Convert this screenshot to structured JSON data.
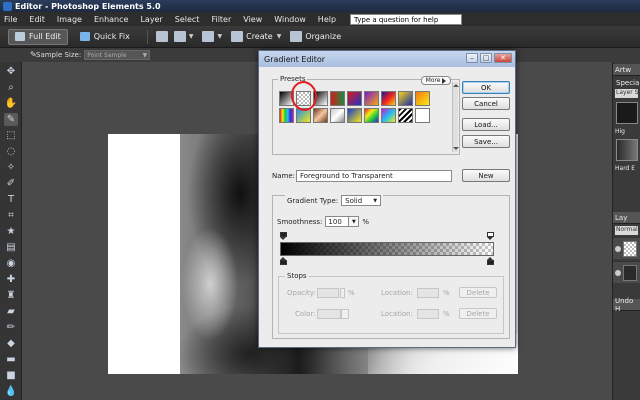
{
  "titlebar": {
    "title": "Editor - Photoshop Elements 5.0"
  },
  "menu": {
    "items": [
      "File",
      "Edit",
      "Image",
      "Enhance",
      "Layer",
      "Select",
      "Filter",
      "View",
      "Window",
      "Help"
    ],
    "help_placeholder": "Type a question for help"
  },
  "modebar": {
    "full_edit": "Full Edit",
    "quick_fix": "Quick Fix",
    "create": "Create",
    "organize": "Organize"
  },
  "options": {
    "sample_size_label": "Sample Size:",
    "sample_size_value": "Point Sample"
  },
  "tools": [
    "move",
    "zoom",
    "hand",
    "eyedropper",
    "marquee",
    "lasso",
    "magic-wand",
    "selection-brush",
    "type",
    "crop",
    "cookie-cutter",
    "straighten",
    "red-eye",
    "healing-brush",
    "clone-stamp",
    "eraser",
    "brush",
    "paint-bucket",
    "gradient",
    "shape",
    "blur",
    "sponge",
    "color-swatch"
  ],
  "rightpanel": {
    "artwork_tab": "Artw",
    "special_label": "Specia",
    "layer_styles_select": "Layer Styles",
    "high_label": "Hig",
    "hard_edge_label": "Hard E",
    "layers_tab": "Lay",
    "blend_mode": "Normal",
    "undo_tab": "Undo H"
  },
  "dialog": {
    "title": "Gradient Editor",
    "presets_label": "Presets",
    "more_label": "More",
    "buttons": {
      "ok": "OK",
      "cancel": "Cancel",
      "load": "Load...",
      "save": "Save...",
      "new": "New"
    },
    "name_label": "Name:",
    "name_value": "Foreground to Transparent",
    "gradient_type_label": "Gradient Type:",
    "gradient_type_value": "Solid",
    "smoothness_label": "Smoothness:",
    "smoothness_value": "100",
    "smoothness_unit": "%",
    "stops_label": "Stops",
    "opacity_label": "Opacity:",
    "color_label": "Color:",
    "location_label": "Location:",
    "percent": "%",
    "delete_label": "Delete",
    "preset_swatches": [
      "linear-gradient(135deg, #000 0%, #fff 100%)",
      "repeating-conic-gradient(#bbb 0% 25%, #fff 0% 50%) 0 0 / 4px 4px",
      "linear-gradient(135deg, #000 0%, #fff 100%)",
      "linear-gradient(90deg, #d21c1c 0%, #1c8b3a 100%)",
      "linear-gradient(135deg, #d21c1c 0%, #2431c9 100%)",
      "linear-gradient(135deg, #7b1cc9 0%, #f5a615 100%)",
      "linear-gradient(135deg, #1a1a9b 0%, #f11f1f 50%, #f5d415 100%)",
      "linear-gradient(135deg, #f5d415 0%, #1c2ea8 100%)",
      "linear-gradient(135deg, #f57a15 0%, #f5ea15 100%)",
      "linear-gradient(90deg, #f21c1c, #f5ea15, #1cc93a, #1cbff5, #2b2bd2, #c91cc9)",
      "linear-gradient(135deg, #1c8bf5 0%, #f5ea15 100%)",
      "linear-gradient(135deg, #6e3a1c 0%, #f5c7a1 50%, #6e3a1c 100%)",
      "linear-gradient(135deg, #c9c9c9 0%, #ffffff 50%, #8a8a8a 100%)",
      "linear-gradient(135deg, #1c3ac9 0%, #f5ea15 100%)",
      "linear-gradient(135deg, #f21c1c 0%, #f5ea15 33%, #1cc93a 66%, #2b2bd2 100%)",
      "linear-gradient(135deg, #c91cc9 0%, #1cbff5 50%, #f5ea15 100%)",
      "repeating-linear-gradient(135deg, #000 0 2px, #fff 2px 4px)",
      "linear-gradient(135deg, #fff 0%, #fff 100%)"
    ]
  }
}
